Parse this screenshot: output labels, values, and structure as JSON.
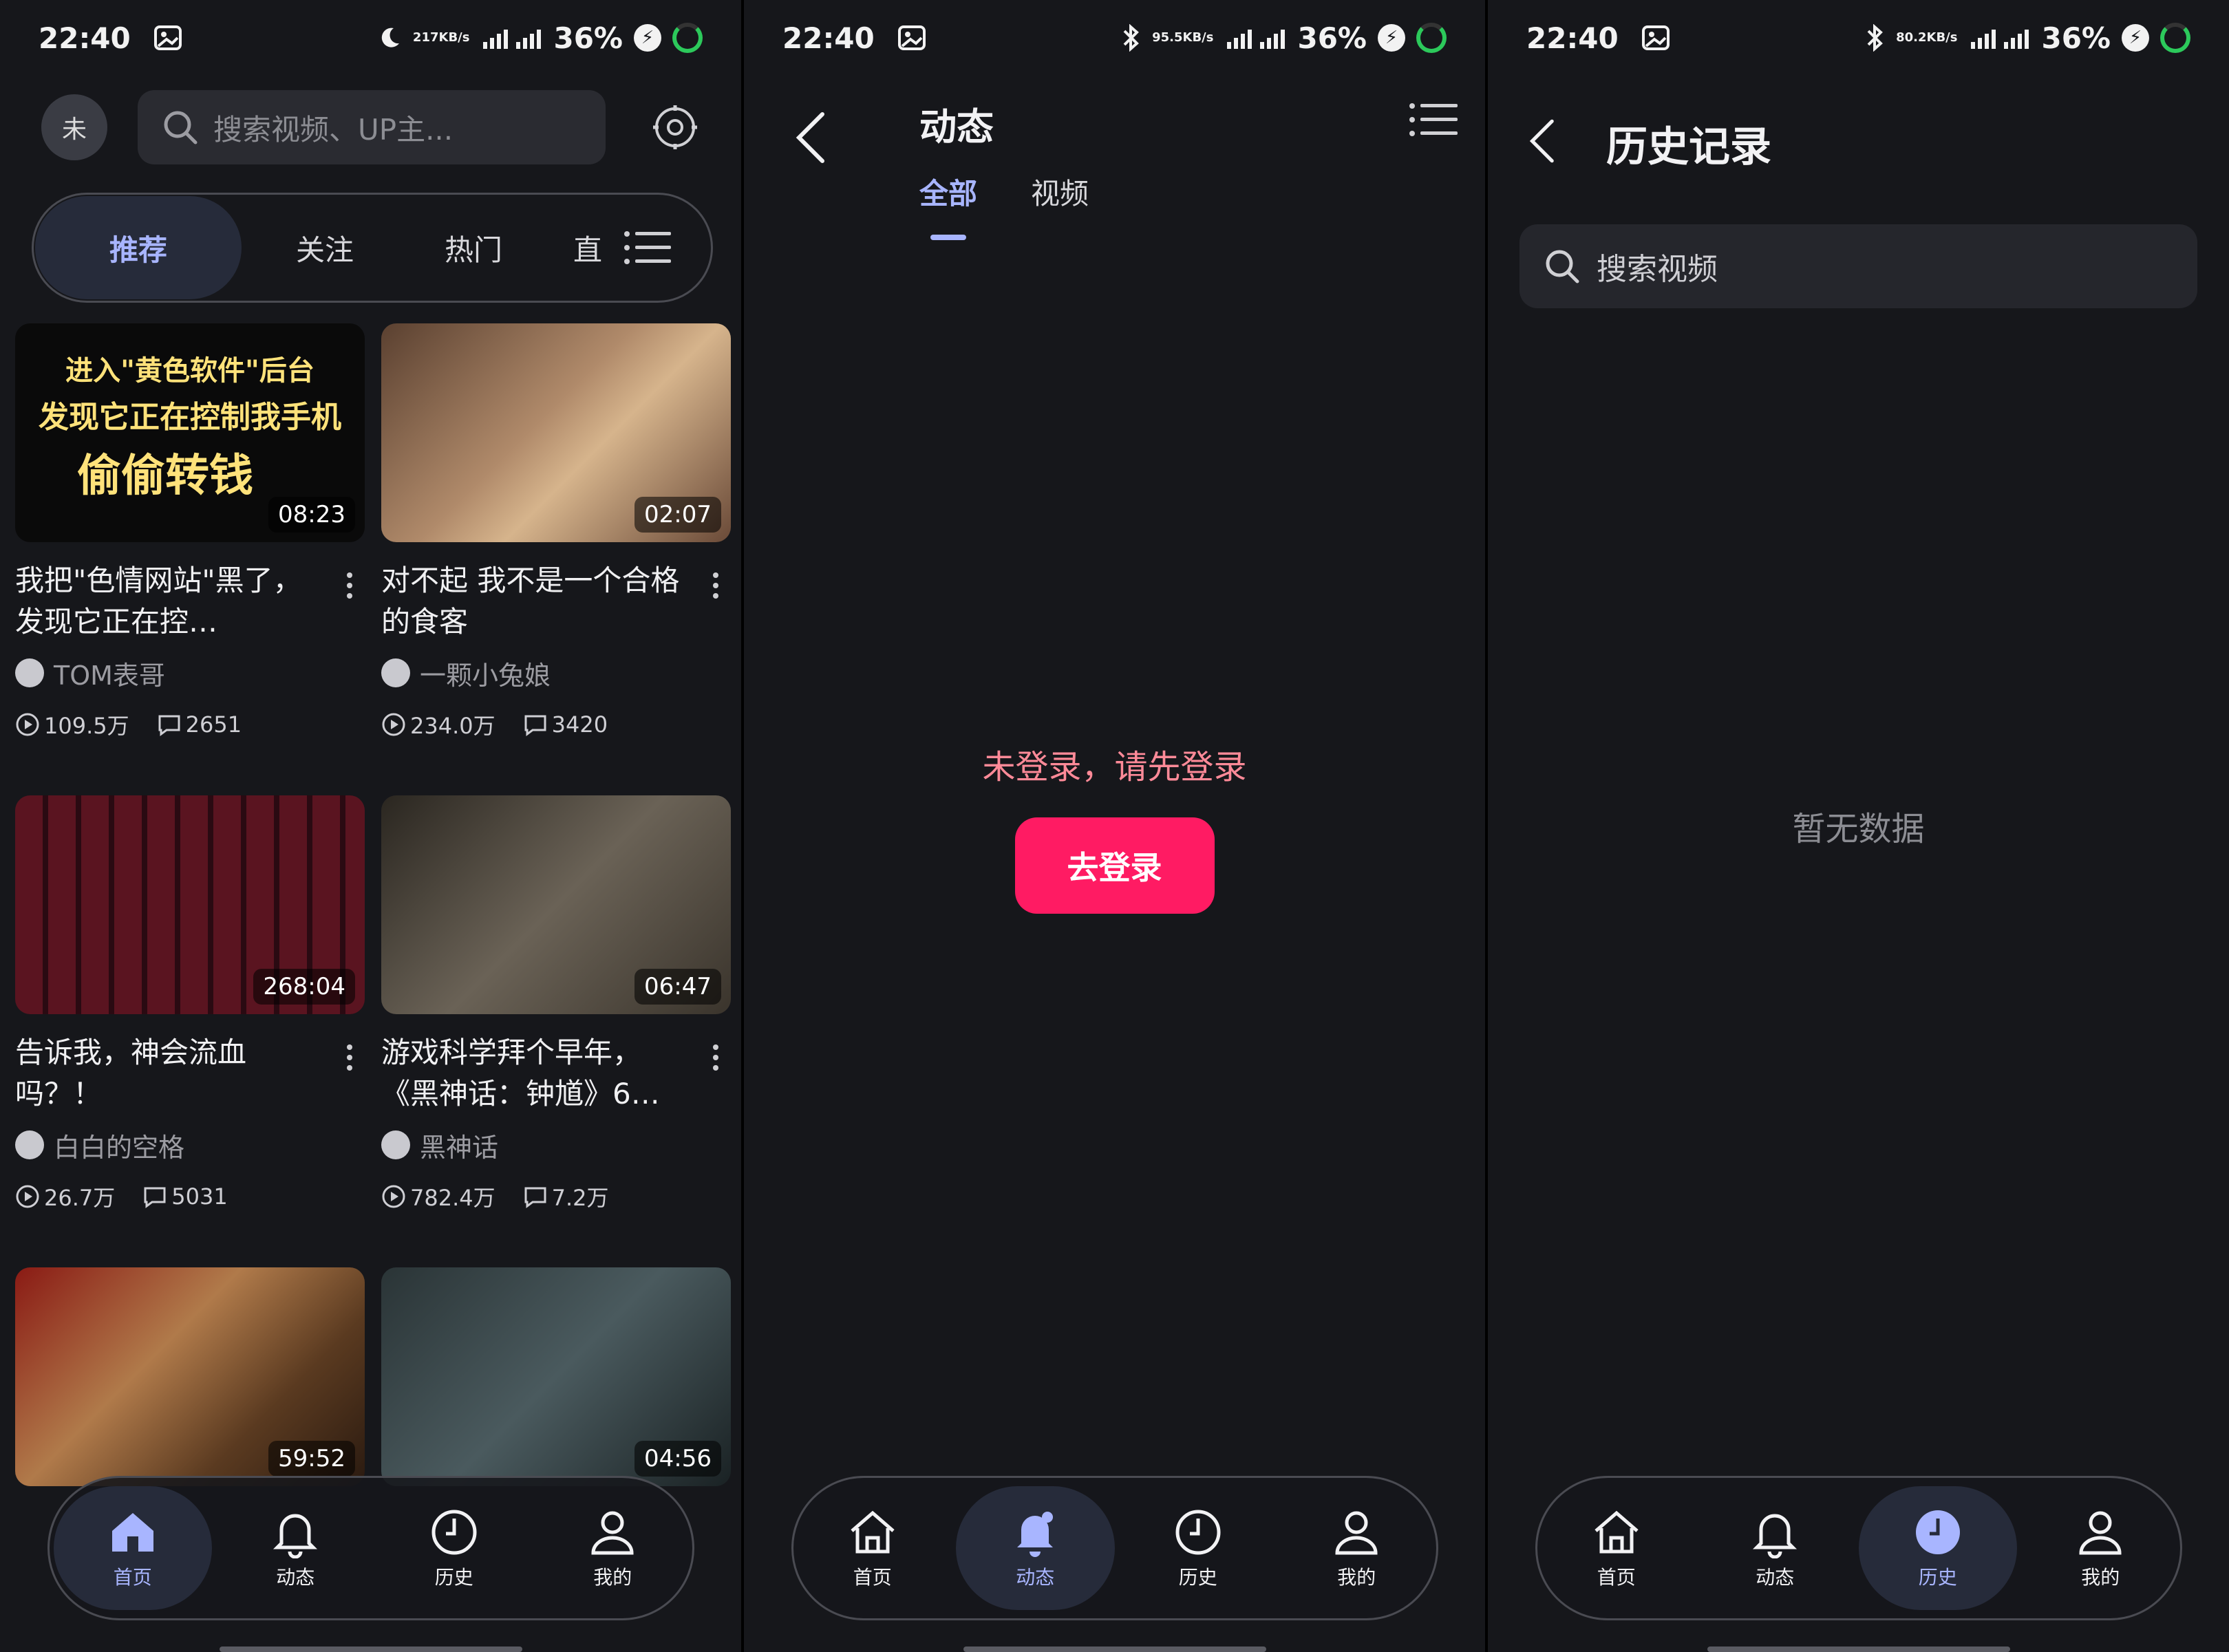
{
  "status": {
    "time": "22:40",
    "battery": "36%",
    "screens": [
      {
        "speed_value": "217",
        "speed_unit": "KB/s"
      },
      {
        "speed_value": "95.5",
        "speed_unit": "KB/s"
      },
      {
        "speed_value": "80.2",
        "speed_unit": "KB/s"
      }
    ]
  },
  "home": {
    "avatar_text": "未",
    "search_placeholder": "搜索视频、UP主...",
    "tabs": [
      "推荐",
      "关注",
      "热门",
      "直"
    ],
    "videos": [
      {
        "title": "我把\"色情网站\"黑了，发现它正在控…",
        "author": "TOM表哥",
        "views": "109.5万",
        "comments": "2651",
        "duration": "08:23",
        "thumb_text_1": "进入\"黄色软件\"后台",
        "thumb_text_2": "发现它正在控制我手机",
        "thumb_text_3": "偷偷转钱"
      },
      {
        "title": "对不起 我不是一个合格的食客",
        "author": "一颗小兔娘",
        "views": "234.0万",
        "comments": "3420",
        "duration": "02:07"
      },
      {
        "title": "告诉我，神会流血吗？！",
        "author": "白白的空格",
        "views": "26.7万",
        "comments": "5031",
        "duration": "268:04"
      },
      {
        "title": "游戏科学拜个早年，《黑神话：钟馗》6…",
        "author": "黑神话",
        "views": "782.4万",
        "comments": "7.2万",
        "duration": "06:47"
      },
      {
        "duration": "59:52"
      },
      {
        "duration": "04:56"
      }
    ]
  },
  "dynamics": {
    "title": "动态",
    "tabs": [
      "全部",
      "视频"
    ],
    "not_logged_in": "未登录，请先登录",
    "login_button": "去登录"
  },
  "history": {
    "title": "历史记录",
    "search_placeholder": "搜索视频",
    "empty": "暂无数据"
  },
  "nav": [
    "首页",
    "动态",
    "历史",
    "我的"
  ],
  "colors": {
    "accent": "#a8b5ff",
    "login_button": "#ff1b63",
    "warning_text": "#ff8a98",
    "background": "#16171b"
  }
}
